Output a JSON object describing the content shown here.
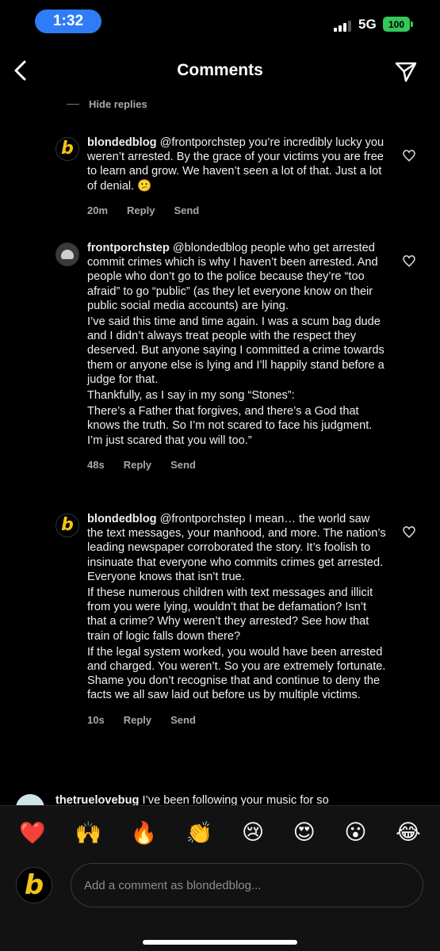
{
  "status_bar": {
    "time": "1:32",
    "network": "5G",
    "battery": "100"
  },
  "header": {
    "title": "Comments"
  },
  "thread": {
    "hide_replies": "Hide replies"
  },
  "comments": [
    {
      "username": "blondedblog",
      "paragraphs": [
        "@frontporchstep  you’re incredibly lucky you weren’t arrested. By the grace of your victims you are free to learn and grow. We haven’t seen a lot of that. Just a lot of denial. 😕"
      ],
      "time": "20m",
      "reply": "Reply",
      "send": "Send"
    },
    {
      "username": "frontporchstep",
      "paragraphs": [
        "@blondedblog people who get arrested commit crimes which is why I haven’t been arrested. And people who don’t go to the police because they’re “too afraid” to go “public” (as they let everyone know on their public social media accounts) are lying.",
        "I’ve said this time and time again. I was a scum bag dude and I didn’t always treat people with the respect they deserved. But anyone saying I committed a crime towards them or anyone else is lying and I’ll happily stand before a judge for that.",
        "Thankfully, as I say in my song “Stones”:",
        "There’s a Father that forgives, and there’s a God that knows the truth. So I’m not scared to face his judgment. I’m just scared that you will too.”"
      ],
      "time": "48s",
      "reply": "Reply",
      "send": "Send"
    },
    {
      "username": "blondedblog",
      "paragraphs": [
        "@frontporchstep I mean… the world saw the text messages, your manhood, and more. The nation’s leading newspaper corroborated the story. It’s foolish to insinuate that everyone who commits crimes get arrested. Everyone knows that isn’t true.",
        "If these numerous children with text messages and illicit from you were lying, wouldn’t that be defamation? Isn’t that a crime? Why weren’t they arrested? See how that train of logic falls down there?",
        "If the legal system worked, you would have been arrested and charged. You weren’t. So you are extremely fortunate. Shame you don’t recognise that and continue to deny the facts we all saw laid out before us by multiple victims."
      ],
      "time": "10s",
      "reply": "Reply",
      "send": "Send"
    }
  ],
  "next_comment": {
    "username": "thetruelovebug",
    "text": "I’ve been following your music for so"
  },
  "emoji_bar": [
    "❤️",
    "🙌",
    "🔥",
    "👏",
    "😢",
    "😍",
    "😮",
    "😂"
  ],
  "composer": {
    "avatar_letter": "b",
    "placeholder": "Add a comment as blondedblog..."
  },
  "colors": {
    "time_pill": "#2f7cf6",
    "battery": "#35c759",
    "brand_yellow": "#f2c318"
  }
}
